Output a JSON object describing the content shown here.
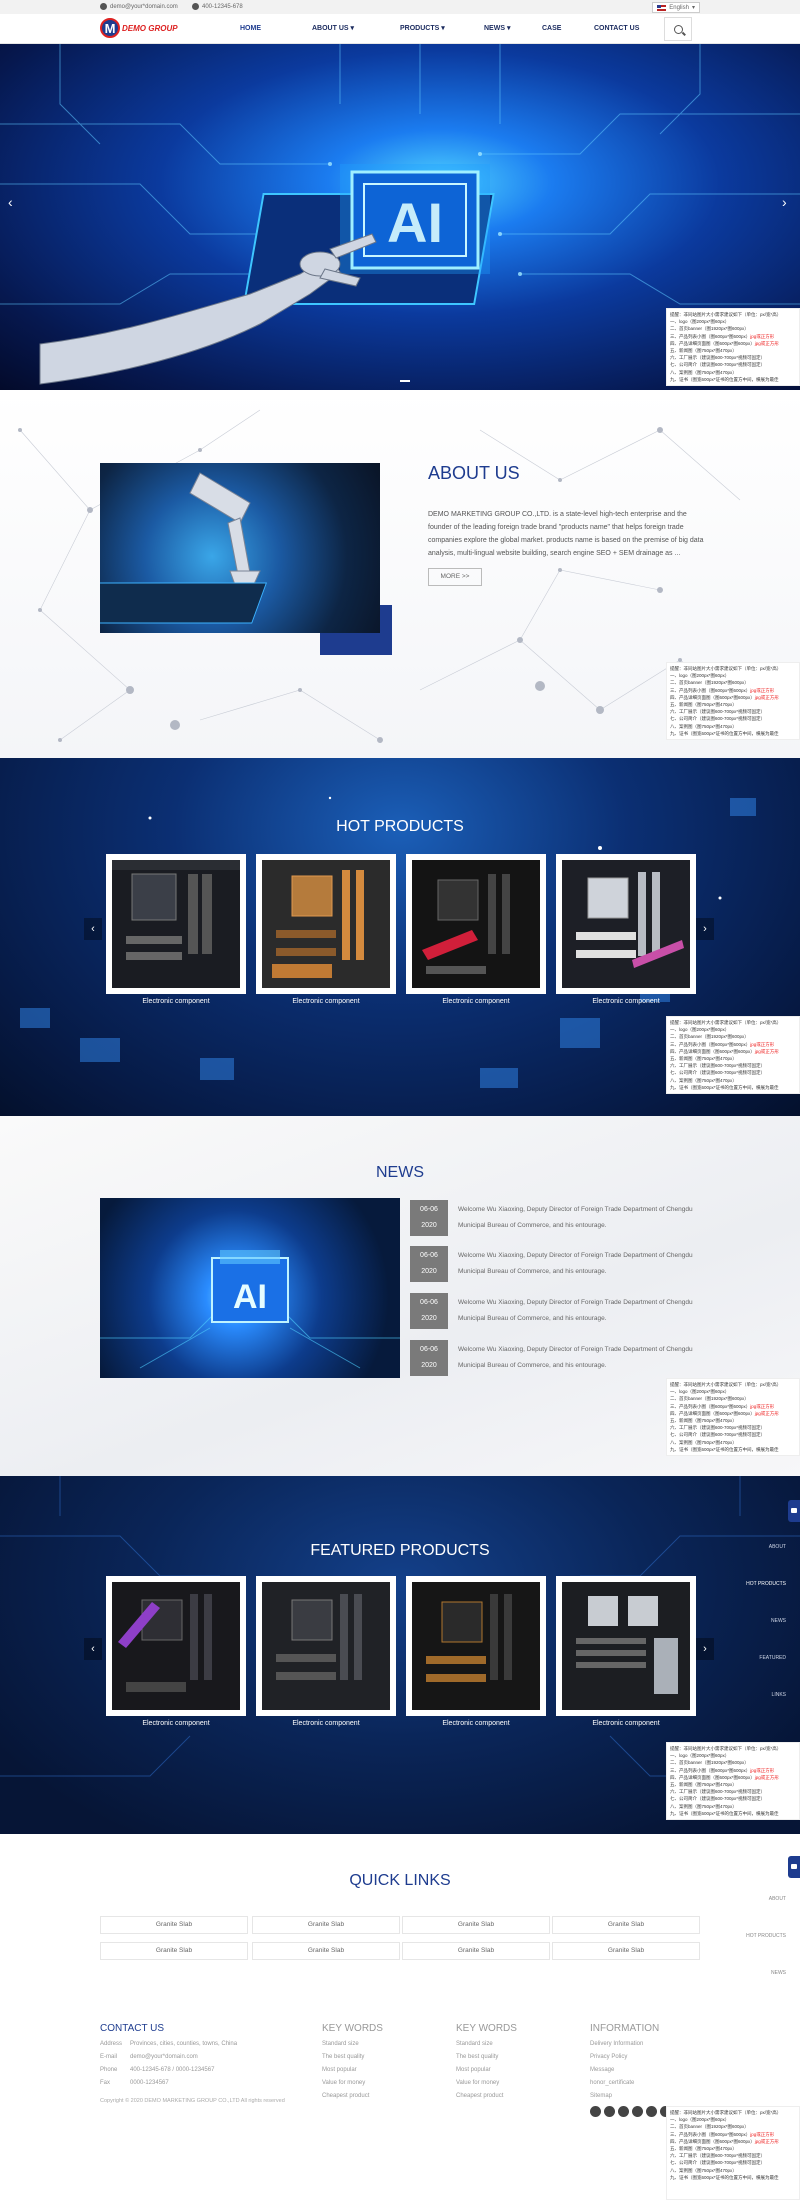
{
  "topbar": {
    "email": "demo@your*domain.com",
    "phone": "400-12345-678",
    "language": "English"
  },
  "header": {
    "logo_text": "DEMO GROUP",
    "nav": [
      "HOME",
      "ABOUT US",
      "PRODUCTS",
      "NEWS",
      "CASE",
      "CONTACT US"
    ]
  },
  "side_notes": {
    "lines": [
      "提醒：非同站图片大小需求建议如下（单位：px/宽*高）",
      "一、logo（图200px*图60px）",
      "二、首页banner（图1920px*图600px）",
      "三、产品列表小图（图600px*图600px）jpg或正方形",
      "四、产品详细页面图（图600px*图600px）jpg或正方形",
      "五、新闻图（图750px*图470px）",
      "六、工厂展示（建议图600-700px*视频可固定）",
      "七、公司简介（建议图600-700px*视频可固定）",
      "八、案例图（图750px*图470px）",
      "九、证书（图宽600px*证书的位置方中间，横展为最佳"
    ],
    "red_suffix": "jpg或正方形"
  },
  "side_nav": [
    "ABOUT",
    "HOT PRODUCTS",
    "NEWS",
    "FEATURED",
    "LINKS"
  ],
  "about": {
    "title": "ABOUT US",
    "text": "DEMO MARKETING GROUP CO.,LTD. is a state-level high-tech enterprise and the founder of the leading foreign trade brand \"products name\" that helps foreign trade companies explore the global market. products name is based on the premise of big data analysis, multi-lingual website building, search engine SEO + SEM drainage as ...",
    "more": "MORE >>"
  },
  "hot_products": {
    "title": "HOT PRODUCTS",
    "items": [
      "Electronic component",
      "Electronic component",
      "Electronic component",
      "Electronic component"
    ]
  },
  "news": {
    "title": "NEWS",
    "items": [
      {
        "day": "06-06",
        "year": "2020",
        "text": "Welcome Wu Xiaoxing, Deputy Director of Foreign Trade Department of Chengdu Municipal Bureau of Commerce, and his entourage."
      },
      {
        "day": "06-06",
        "year": "2020",
        "text": "Welcome Wu Xiaoxing, Deputy Director of Foreign Trade Department of Chengdu Municipal Bureau of Commerce, and his entourage."
      },
      {
        "day": "06-06",
        "year": "2020",
        "text": "Welcome Wu Xiaoxing, Deputy Director of Foreign Trade Department of Chengdu Municipal Bureau of Commerce, and his entourage."
      },
      {
        "day": "06-06",
        "year": "2020",
        "text": "Welcome Wu Xiaoxing, Deputy Director of Foreign Trade Department of Chengdu Municipal Bureau of Commerce, and his entourage."
      }
    ]
  },
  "featured_products": {
    "title": "FEATURED PRODUCTS",
    "items": [
      "Electronic component",
      "Electronic component",
      "Electronic component",
      "Electronic component"
    ]
  },
  "quick_links": {
    "title": "QUICK LINKS",
    "items": [
      "Granite Slab",
      "Granite Slab",
      "Granite Slab",
      "Granite Slab",
      "Granite Slab",
      "Granite Slab",
      "Granite Slab",
      "Granite Slab"
    ]
  },
  "footer": {
    "contact": {
      "title": "CONTACT US",
      "address_label": "Address",
      "address": "Provinces, cities, counties, towns, China",
      "email_label": "E-mail",
      "email": "demo@your*domain.com",
      "phone_label": "Phone",
      "phone": "400-12345-678 / 0000-1234567",
      "fax_label": "Fax",
      "fax": "0000-1234567"
    },
    "keywords1": {
      "title": "KEY WORDS",
      "items": [
        "Standard size",
        "The best quality",
        "Most popular",
        "Value for money",
        "Cheapest product"
      ]
    },
    "keywords2": {
      "title": "KEY WORDS",
      "items": [
        "Standard size",
        "The best quality",
        "Most popular",
        "Value for money",
        "Cheapest product"
      ]
    },
    "information": {
      "title": "INFORMATION",
      "items": [
        "Delivery Information",
        "Privacy Policy",
        "Message",
        "honor_certificate",
        "Sitemap"
      ]
    },
    "copyright": "Copyright © 2020 DEMO MARKETING GROUP CO.,LTD All rights reserved"
  },
  "colors": {
    "brand": "#1e3c8f",
    "accent": "#d22222"
  }
}
